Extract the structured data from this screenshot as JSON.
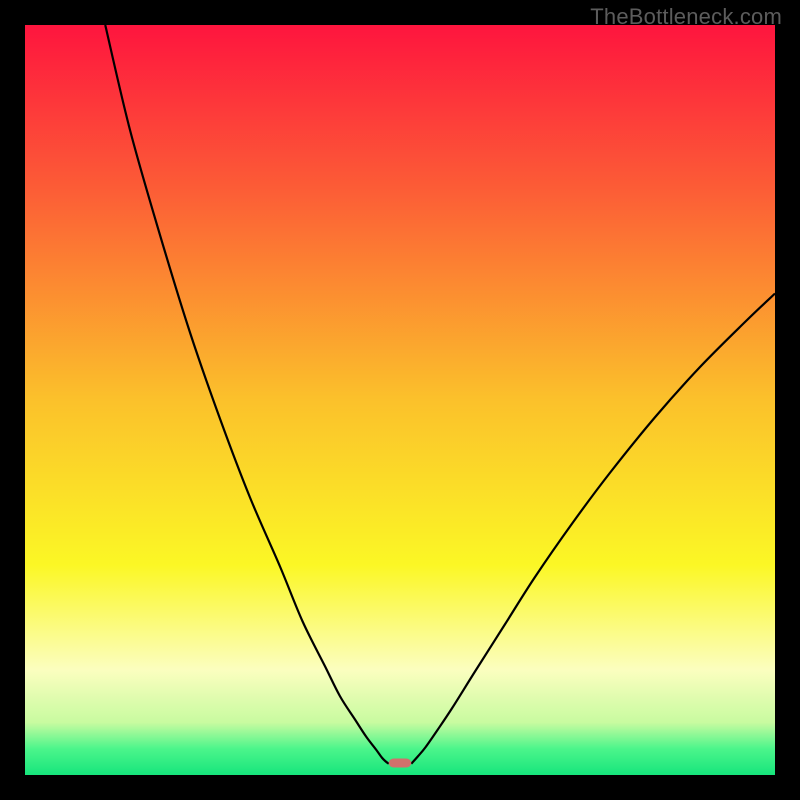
{
  "watermark": "TheBottleneck.com",
  "chart_data": {
    "type": "line",
    "title": "",
    "xlabel": "",
    "ylabel": "",
    "xlim": [
      0,
      100
    ],
    "ylim": [
      0,
      100
    ],
    "grid": false,
    "legend": false,
    "background_gradient_stops": [
      {
        "offset": 0.0,
        "color": "#fe153e"
      },
      {
        "offset": 0.22,
        "color": "#fc5d36"
      },
      {
        "offset": 0.5,
        "color": "#fbc12b"
      },
      {
        "offset": 0.72,
        "color": "#fbf725"
      },
      {
        "offset": 0.86,
        "color": "#fbfebf"
      },
      {
        "offset": 0.93,
        "color": "#c8fba0"
      },
      {
        "offset": 0.965,
        "color": "#4cf58b"
      },
      {
        "offset": 1.0,
        "color": "#16e57c"
      }
    ],
    "series": [
      {
        "name": "left-branch",
        "x": [
          10.7,
          14,
          18,
          22,
          26,
          30,
          34,
          37,
          40,
          42,
          44,
          45.5,
          46.8,
          47.6,
          48.1,
          48.5
        ],
        "y": [
          100,
          86,
          72,
          59,
          47.5,
          37,
          27.8,
          20.5,
          14.5,
          10.5,
          7.4,
          5.1,
          3.4,
          2.3,
          1.8,
          1.5
        ]
      },
      {
        "name": "right-branch",
        "x": [
          51.5,
          52.4,
          53.4,
          55,
          57,
          60,
          64,
          68,
          73,
          78,
          84,
          90,
          96,
          100
        ],
        "y": [
          1.5,
          2.5,
          3.7,
          6.0,
          9.0,
          13.8,
          20.1,
          26.4,
          33.6,
          40.3,
          47.7,
          54.4,
          60.4,
          64.2
        ]
      }
    ],
    "bottleneck_marker": {
      "x_start": 48.5,
      "x_end": 51.5,
      "y": 1.0,
      "height": 1.2,
      "color": "#d1706c"
    }
  }
}
